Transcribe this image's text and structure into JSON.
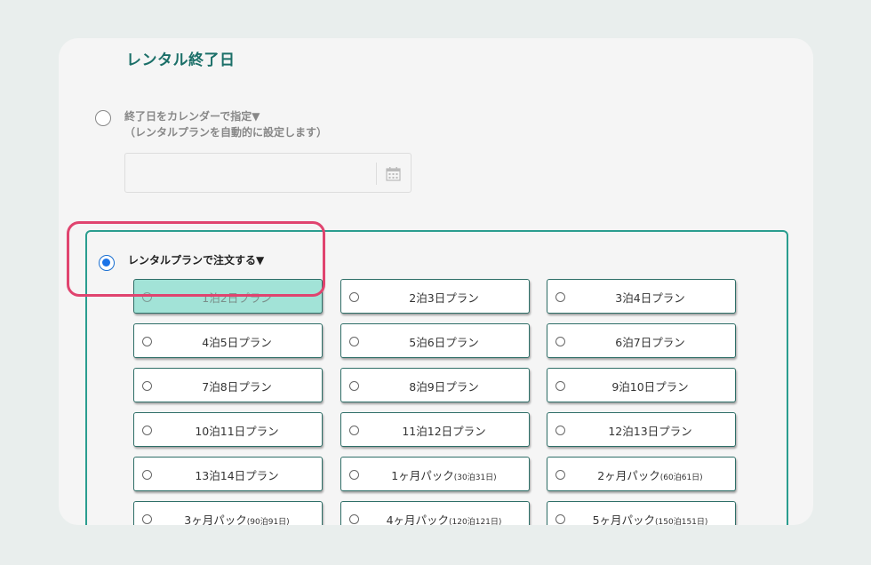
{
  "section_title": "レンタル終了日",
  "option_calendar": {
    "line1": "終了日をカレンダーで指定▼",
    "line2": "（レンタルプランを自動的に設定します）"
  },
  "date_input": {
    "value": "",
    "placeholder": ""
  },
  "option_plan": {
    "label": "レンタルプランで注文する▼"
  },
  "plans": [
    {
      "label": "1泊2日プラン",
      "sub": "",
      "selected": true
    },
    {
      "label": "2泊3日プラン",
      "sub": "",
      "selected": false
    },
    {
      "label": "3泊4日プラン",
      "sub": "",
      "selected": false
    },
    {
      "label": "4泊5日プラン",
      "sub": "",
      "selected": false
    },
    {
      "label": "5泊6日プラン",
      "sub": "",
      "selected": false
    },
    {
      "label": "6泊7日プラン",
      "sub": "",
      "selected": false
    },
    {
      "label": "7泊8日プラン",
      "sub": "",
      "selected": false
    },
    {
      "label": "8泊9日プラン",
      "sub": "",
      "selected": false
    },
    {
      "label": "9泊10日プラン",
      "sub": "",
      "selected": false
    },
    {
      "label": "10泊11日プラン",
      "sub": "",
      "selected": false
    },
    {
      "label": "11泊12日プラン",
      "sub": "",
      "selected": false
    },
    {
      "label": "12泊13日プラン",
      "sub": "",
      "selected": false
    },
    {
      "label": "13泊14日プラン",
      "sub": "",
      "selected": false
    },
    {
      "label": "1ヶ月パック",
      "sub": "(30泊31日)",
      "selected": false
    },
    {
      "label": "2ヶ月パック",
      "sub": "(60泊61日)",
      "selected": false
    },
    {
      "label": "3ヶ月パック",
      "sub": "(90泊91日)",
      "selected": false
    },
    {
      "label": "4ヶ月パック",
      "sub": "(120泊121日)",
      "selected": false
    },
    {
      "label": "5ヶ月パック",
      "sub": "(150泊151日)",
      "selected": false
    }
  ],
  "colors": {
    "title": "#1b6f68",
    "plan_box_border": "#2a9d8f",
    "selected_plan_bg": "#a2e3d7",
    "highlight_border": "#e0446f",
    "radio_checked": "#1a73e8"
  },
  "icons": {
    "date_input": "calendar-icon"
  }
}
